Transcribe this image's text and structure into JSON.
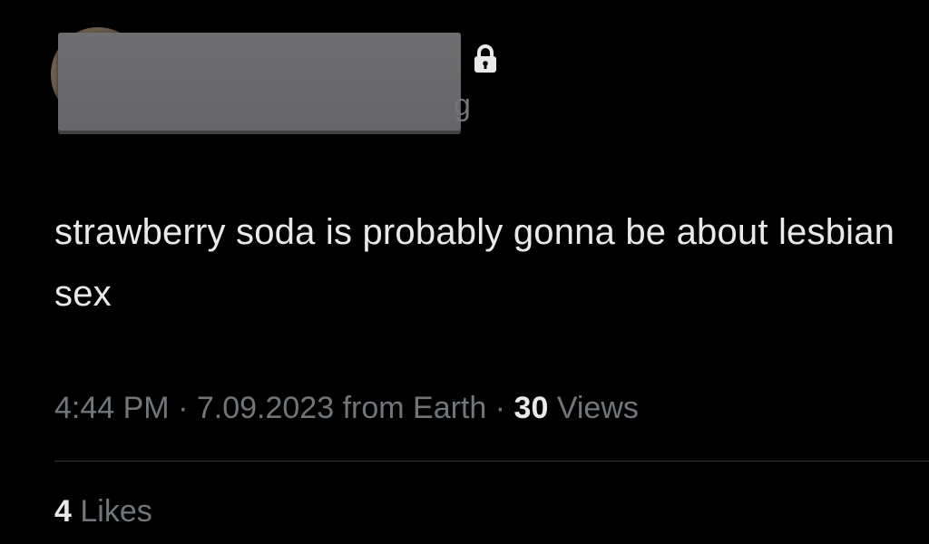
{
  "author": {
    "handle_visible_fragment": "g",
    "protected_icon": "lock-icon"
  },
  "tweet": {
    "text": "strawberry soda is probably gonna be about lesbian sex",
    "time": "4:44 PM",
    "separator": "·",
    "date": "7.09.2023",
    "source": "from Earth",
    "views_count": "30",
    "views_label": "Views"
  },
  "engagement": {
    "likes_count": "4",
    "likes_label": "Likes"
  },
  "colors": {
    "background": "#000000",
    "primary_text": "#e7e9ea",
    "secondary_text": "#71767b",
    "divider": "#2f3336",
    "redaction": "#6f6f72"
  }
}
